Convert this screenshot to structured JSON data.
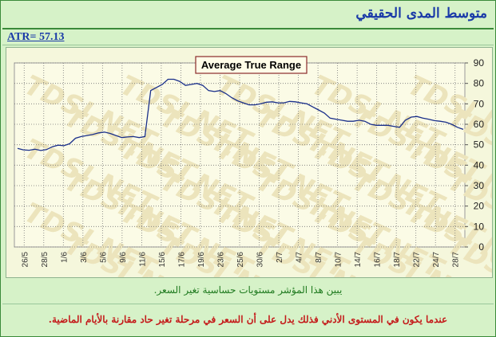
{
  "header": {
    "title": "متوسط المدى الحقيقي",
    "atr_label": "ATR= 57.13"
  },
  "chart_data": {
    "type": "line",
    "title": "Average True Range",
    "ylim": [
      0,
      90
    ],
    "yticks": [
      0,
      10,
      20,
      30,
      40,
      50,
      60,
      70,
      80,
      90
    ],
    "xticklabels": [
      "26/5",
      "28/5",
      "1/6",
      "3/6",
      "5/6",
      "9/6",
      "11/6",
      "15/6",
      "17/6",
      "19/6",
      "23/6",
      "25/6",
      "30/6",
      "2/7",
      "4/7",
      "8/7",
      "10/7",
      "14/7",
      "16/7",
      "18/7",
      "22/7",
      "24/7",
      "28/7"
    ],
    "grid": true,
    "watermark": "TDSI.NET",
    "series": [
      {
        "values": [
          48.2,
          47.5,
          47.3,
          47.8,
          47.2,
          47.6,
          49.0,
          49.8,
          49.5,
          50.5,
          53.2,
          54.0,
          54.5,
          55.0,
          55.8,
          56.2,
          55.5,
          54.5,
          53.5,
          53.8,
          54.0,
          53.5,
          54.0,
          76.5,
          78.0,
          79.5,
          82.0,
          82.0,
          81.0,
          79.0,
          79.5,
          80.0,
          79.0,
          76.5,
          76.0,
          76.5,
          75.0,
          73.0,
          71.5,
          70.5,
          69.5,
          69.5,
          70.0,
          70.8,
          71.0,
          70.5,
          70.5,
          71.2,
          71.0,
          70.5,
          70.0,
          68.5,
          67.0,
          65.5,
          63.0,
          62.5,
          62.0,
          61.5,
          61.5,
          62.0,
          61.5,
          60.0,
          59.5,
          59.5,
          59.5,
          59.0,
          58.5,
          62.0,
          63.5,
          63.8,
          63.0,
          62.5,
          61.8,
          61.5,
          61.0,
          60.0,
          58.5,
          57.5
        ],
        "color": "#1a2f8a"
      }
    ]
  },
  "footer": {
    "line1": "يبين هذا المؤشر مستويات حساسية تغير السعر.",
    "line2": "عندما يكون في المستوى الأدني فذلك يدل على أن السعر في مرحلة تغير حاد مقارنة بالأيام الماضية."
  },
  "colors": {
    "background": "#d6f2c8",
    "plot_background": "#fbfbe6",
    "line": "#1a2f8a",
    "title_text": "#1a3aa8",
    "desc_green": "#1f7a1f",
    "desc_red": "#c41a1a"
  }
}
